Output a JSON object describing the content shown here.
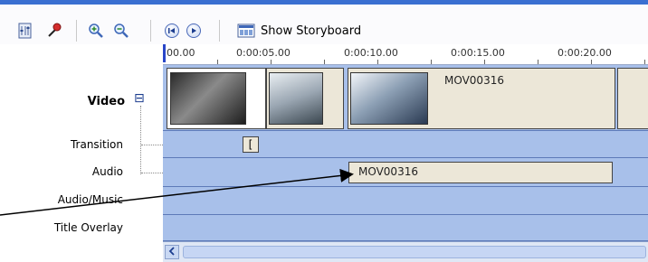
{
  "toolbar": {
    "storyboard_label": "Show Storyboard"
  },
  "ruler": {
    "ticks": [
      "00.00",
      "0:00:05.00",
      "0:00:10.00",
      "0:00:15.00",
      "0:00:20.00"
    ]
  },
  "tracks": {
    "video": "Video",
    "collapse_symbol": "⊟",
    "transition": "Transition",
    "audio": "Audio",
    "audio_music": "Audio/Music",
    "title_overlay": "Title Overlay"
  },
  "clips": {
    "video_clip_title": "MOV00316",
    "transition_marker": "[",
    "audio_clip_title": "MOV00316"
  },
  "colors": {
    "timeline_bg": "#a8c0ea",
    "accent": "#3a6fd1"
  }
}
